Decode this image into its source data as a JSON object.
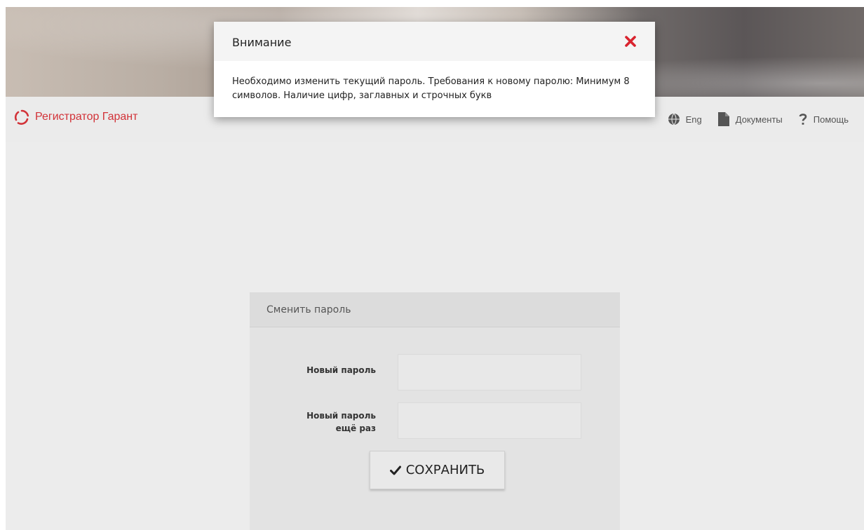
{
  "brand": {
    "name": "Регистратор Гарант",
    "accent": "#d23238"
  },
  "nav": {
    "language": "Eng",
    "documents": "Документы",
    "help": "Помощь"
  },
  "form": {
    "title": "Сменить пароль",
    "new_password_label": "Новый пароль",
    "repeat_password_label_line1": "Новый пароль",
    "repeat_password_label_line2": "ещё раз",
    "new_password_value": "",
    "repeat_password_value": "",
    "save_label": "СОХРАНИТЬ"
  },
  "modal": {
    "title": "Внимание",
    "message": "Необходимо изменить текущий пароль. Требования к новому паролю: Минимум 8 символов. Наличие цифр, заглавных и строчных букв",
    "close_color": "#d9232e"
  },
  "icons": {
    "logo": "logo-icon",
    "language": "globe-icon",
    "documents": "document-icon",
    "help": "question-icon",
    "save": "check-icon",
    "close": "close-icon"
  }
}
